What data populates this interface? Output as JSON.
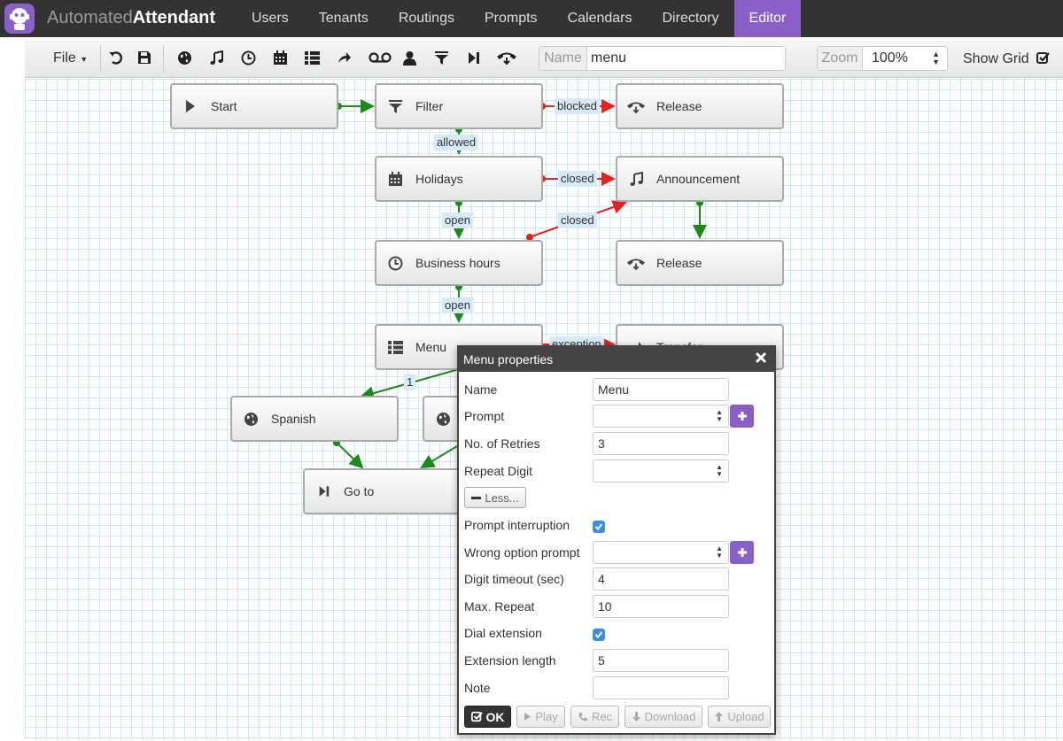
{
  "app": {
    "brand_light": "Automated",
    "brand_bold": "Attendant",
    "accent_color": "#8a5fc7"
  },
  "nav": {
    "items": [
      {
        "label": "Users"
      },
      {
        "label": "Tenants"
      },
      {
        "label": "Routings"
      },
      {
        "label": "Prompts"
      },
      {
        "label": "Calendars"
      },
      {
        "label": "Directory"
      },
      {
        "label": "Editor",
        "active": true
      }
    ]
  },
  "toolbar": {
    "file_label": "File",
    "icons": [
      "undo-icon",
      "save-icon",
      "globe-icon",
      "music-icon",
      "clock-icon",
      "calendar-icon",
      "list-icon",
      "forward-arrow-icon",
      "voicemail-icon",
      "user-icon",
      "filter-icon",
      "step-forward-icon",
      "hangup-icon"
    ],
    "name_addon": "Name",
    "name_value": "menu",
    "zoom_addon": "Zoom",
    "zoom_value": "100%",
    "show_grid_label": "Show Grid",
    "show_grid_checked": true
  },
  "flow": {
    "nodes": {
      "start": "Start",
      "filter": "Filter",
      "release1": "Release",
      "holidays": "Holidays",
      "announcement": "Announcement",
      "business_hours": "Business hours",
      "release2": "Release",
      "menu": "Menu",
      "transfer": "Transfer",
      "spanish": "Spanish",
      "goto": "Go to"
    },
    "edge_labels": {
      "blocked": "blocked",
      "allowed": "allowed",
      "closed1": "closed",
      "closed2": "closed",
      "open1": "open",
      "open2": "open",
      "one": "1",
      "exception": "exception"
    },
    "colors": {
      "success": "#1a8a1a",
      "failure": "#e82020"
    }
  },
  "dialog": {
    "title": "Menu properties",
    "fields": {
      "name_label": "Name",
      "name_value": "Menu",
      "prompt_label": "Prompt",
      "retries_label": "No. of Retries",
      "retries_value": "3",
      "repeat_digit_label": "Repeat Digit",
      "less_label": "Less...",
      "interruption_label": "Prompt interruption",
      "interruption_checked": true,
      "wrong_option_label": "Wrong option prompt",
      "digit_timeout_label": "Digit timeout (sec)",
      "digit_timeout_value": "4",
      "max_repeat_label": "Max. Repeat",
      "max_repeat_value": "10",
      "dial_ext_label": "Dial extension",
      "dial_ext_checked": true,
      "ext_length_label": "Extension length",
      "ext_length_value": "5",
      "note_label": "Note",
      "note_value": ""
    },
    "buttons": {
      "ok": "OK",
      "play": "Play",
      "rec": "Rec",
      "download": "Download",
      "upload": "Upload"
    }
  }
}
